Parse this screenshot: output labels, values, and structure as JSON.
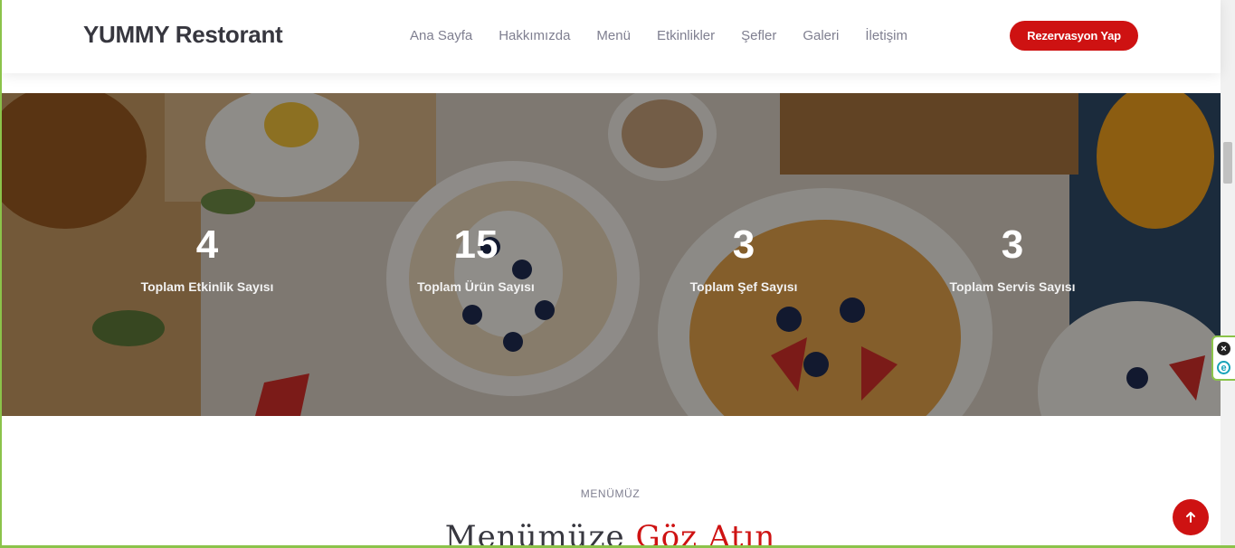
{
  "header": {
    "logo": "YUMMY Restorant",
    "nav": [
      "Ana Sayfa",
      "Hakkımızda",
      "Menü",
      "Etkinlikler",
      "Şefler",
      "Galeri",
      "İletişim"
    ],
    "reserve_button": "Rezervasyon Yap"
  },
  "stats": [
    {
      "value": "4",
      "label": "Toplam Etkinlik Sayısı"
    },
    {
      "value": "15",
      "label": "Toplam Ürün Sayısı"
    },
    {
      "value": "3",
      "label": "Toplam Şef Sayısı"
    },
    {
      "value": "3",
      "label": "Toplam Servis Sayısı"
    }
  ],
  "menu_section": {
    "subtitle": "MENÜMÜZ",
    "title_part1": "Menümüze",
    "title_part2": "Göz Atın"
  },
  "icons": {
    "back_to_top": "arrow-up-icon",
    "widget_close": "close-icon",
    "widget_ext": "extension-icon"
  },
  "colors": {
    "accent": "#ce1212",
    "text_dark": "#37373f",
    "nav_text": "#7f7f90"
  }
}
